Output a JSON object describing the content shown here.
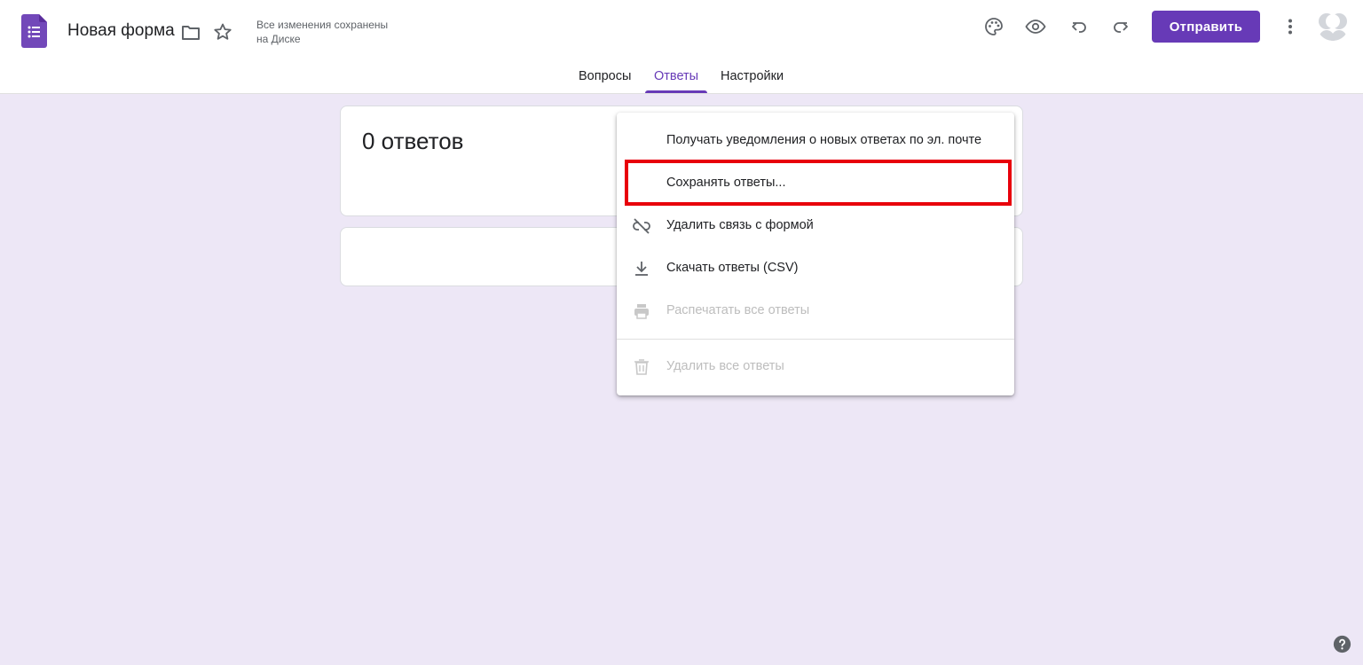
{
  "header": {
    "form_title": "Новая форма",
    "save_status_line1": "Все изменения сохранены",
    "save_status_line2": "на Диске",
    "send_label": "Отправить",
    "icons": [
      "forms-logo-icon",
      "folder-icon",
      "star-icon",
      "palette-icon",
      "preview-eye-icon",
      "undo-icon",
      "redo-icon",
      "more-vert-icon",
      "avatar",
      "help-icon"
    ]
  },
  "tabs": [
    {
      "label": "Вопросы",
      "active": false
    },
    {
      "label": "Ответы",
      "active": true
    },
    {
      "label": "Настройки",
      "active": false
    }
  ],
  "responses": {
    "count_label": "0 ответов"
  },
  "menu": {
    "items": [
      {
        "label": "Получать уведомления о новых ответах по эл. почте",
        "icon": "none",
        "disabled": false
      },
      {
        "label": "Сохранять ответы...",
        "icon": "none",
        "disabled": false,
        "highlighted": true
      },
      {
        "label": "Удалить связь с формой",
        "icon": "unlink-icon",
        "disabled": false
      },
      {
        "label": "Скачать ответы (CSV)",
        "icon": "download-icon",
        "disabled": false
      },
      {
        "label": "Распечатать все ответы",
        "icon": "print-icon",
        "disabled": true
      },
      {
        "label": "Удалить все ответы",
        "icon": "trash-icon",
        "disabled": true
      }
    ]
  },
  "colors": {
    "accent": "#673ab7",
    "background": "#ede7f6",
    "highlight": "#e8000b"
  }
}
